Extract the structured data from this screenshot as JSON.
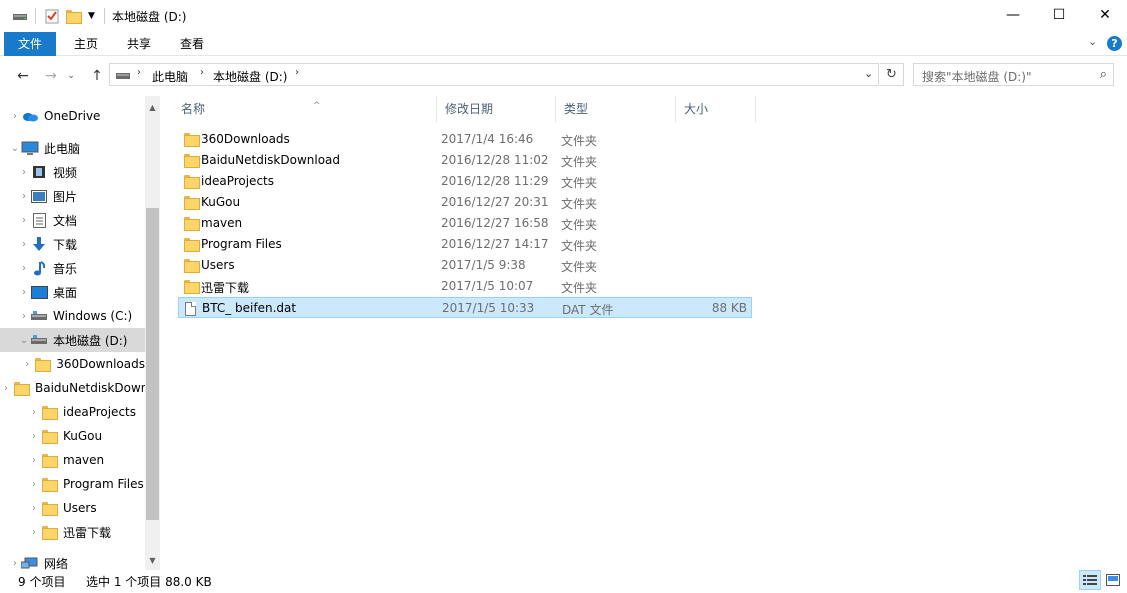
{
  "window": {
    "title": "本地磁盘 (D:)",
    "controls": {
      "minimize": "—",
      "maximize": "☐",
      "close": "✕"
    }
  },
  "ribbon": {
    "tabs": [
      {
        "label": "文件"
      },
      {
        "label": "主页"
      },
      {
        "label": "共享"
      },
      {
        "label": "查看"
      }
    ],
    "accent": "#1979ca"
  },
  "address": {
    "breadcrumbs": [
      "此电脑",
      "本地磁盘 (D:)"
    ],
    "search_placeholder": "搜索\"本地磁盘 (D:)\""
  },
  "nav": {
    "items": [
      {
        "label": "OneDrive",
        "icon": "cloud-icon",
        "level": 0,
        "expander": "›"
      },
      {
        "label": "此电脑",
        "icon": "computer-icon",
        "level": 0,
        "expander": "⌄"
      },
      {
        "label": "视频",
        "icon": "video-icon",
        "level": 1,
        "expander": "›"
      },
      {
        "label": "图片",
        "icon": "pictures-icon",
        "level": 1,
        "expander": "›"
      },
      {
        "label": "文档",
        "icon": "documents-icon",
        "level": 1,
        "expander": "›"
      },
      {
        "label": "下载",
        "icon": "download-icon",
        "level": 1,
        "expander": "›"
      },
      {
        "label": "音乐",
        "icon": "music-icon",
        "level": 1,
        "expander": "›"
      },
      {
        "label": "桌面",
        "icon": "desktop-icon",
        "level": 1,
        "expander": "›"
      },
      {
        "label": "Windows (C:)",
        "icon": "drive-icon",
        "level": 1,
        "expander": "›"
      },
      {
        "label": "本地磁盘 (D:)",
        "icon": "drive-icon",
        "level": 1,
        "expander": "⌄",
        "selected": true
      },
      {
        "label": "360Downloads",
        "icon": "folder-icon",
        "level": 2,
        "expander": "›"
      },
      {
        "label": "BaiduNetdiskDownload",
        "icon": "folder-icon",
        "level": 2,
        "expander": "›"
      },
      {
        "label": "ideaProjects",
        "icon": "folder-icon",
        "level": 2,
        "expander": "›"
      },
      {
        "label": "KuGou",
        "icon": "folder-icon",
        "level": 2,
        "expander": "›"
      },
      {
        "label": "maven",
        "icon": "folder-icon",
        "level": 2,
        "expander": "›"
      },
      {
        "label": "Program Files",
        "icon": "folder-icon",
        "level": 2,
        "expander": "›"
      },
      {
        "label": "Users",
        "icon": "folder-icon",
        "level": 2,
        "expander": "›"
      },
      {
        "label": "迅雷下载",
        "icon": "folder-icon",
        "level": 2,
        "expander": "›"
      },
      {
        "label": "网络",
        "icon": "network-icon",
        "level": 0,
        "expander": "›"
      }
    ]
  },
  "table": {
    "columns": [
      "名称",
      "修改日期",
      "类型",
      "大小"
    ],
    "rows": [
      {
        "name": "360Downloads",
        "date": "2017/1/4 16:46",
        "type": "文件夹",
        "size": "",
        "icon": "folder-icon"
      },
      {
        "name": "BaiduNetdiskDownload",
        "date": "2016/12/28 11:02",
        "type": "文件夹",
        "size": "",
        "icon": "folder-icon"
      },
      {
        "name": "ideaProjects",
        "date": "2016/12/28 11:29",
        "type": "文件夹",
        "size": "",
        "icon": "folder-icon"
      },
      {
        "name": "KuGou",
        "date": "2016/12/27 20:31",
        "type": "文件夹",
        "size": "",
        "icon": "folder-icon"
      },
      {
        "name": "maven",
        "date": "2016/12/27 16:58",
        "type": "文件夹",
        "size": "",
        "icon": "folder-icon"
      },
      {
        "name": "Program Files",
        "date": "2016/12/27 14:17",
        "type": "文件夹",
        "size": "",
        "icon": "folder-icon"
      },
      {
        "name": "Users",
        "date": "2017/1/5 9:38",
        "type": "文件夹",
        "size": "",
        "icon": "folder-icon"
      },
      {
        "name": "迅雷下载",
        "date": "2017/1/5 10:07",
        "type": "文件夹",
        "size": "",
        "icon": "folder-icon"
      },
      {
        "name": "BTC_ beifen.dat",
        "date": "2017/1/5 10:33",
        "type": "DAT 文件",
        "size": "88 KB",
        "icon": "file-icon",
        "selected": true
      }
    ]
  },
  "status": {
    "item_count": "9 个项目",
    "selection": "选中 1 个项目  88.0 KB"
  }
}
